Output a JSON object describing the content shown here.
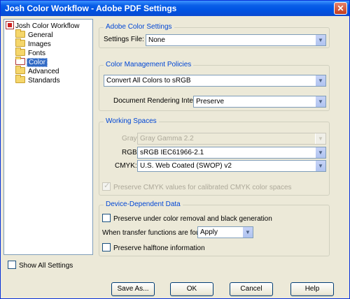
{
  "window": {
    "title": "Josh Color Workflow - Adobe PDF Settings",
    "close_glyph": "✕"
  },
  "tree": {
    "root": "Josh Color Workflow",
    "items": [
      {
        "label": "General",
        "selected": false
      },
      {
        "label": "Images",
        "selected": false
      },
      {
        "label": "Fonts",
        "selected": false
      },
      {
        "label": "Color",
        "selected": true
      },
      {
        "label": "Advanced",
        "selected": false
      },
      {
        "label": "Standards",
        "selected": false
      }
    ]
  },
  "adobe_color_settings": {
    "group_title": "Adobe Color Settings",
    "settings_file_label": "Settings File:",
    "settings_file_value": "None"
  },
  "color_management": {
    "group_title": "Color Management Policies",
    "policy_value": "Convert All Colors to sRGB",
    "rendering_intent_label": "Document Rendering Intent:",
    "rendering_intent_value": "Preserve"
  },
  "working_spaces": {
    "group_title": "Working Spaces",
    "gray_label": "Gray:",
    "gray_value": "Gray Gamma 2.2",
    "rgb_label": "RGB:",
    "rgb_value": "sRGB IEC61966-2.1",
    "cmyk_label": "CMYK:",
    "cmyk_value": "U.S. Web Coated (SWOP) v2",
    "preserve_cmyk_label": "Preserve CMYK values for calibrated CMYK color spaces"
  },
  "device_dependent": {
    "group_title": "Device-Dependent Data",
    "ucr_label": "Preserve under color removal and black generation",
    "transfer_label": "When transfer functions are found:",
    "transfer_value": "Apply",
    "halftone_label": "Preserve halftone information"
  },
  "footer": {
    "show_all_label": "Show All Settings",
    "save_as": "Save As...",
    "ok": "OK",
    "cancel": "Cancel",
    "help": "Help"
  }
}
